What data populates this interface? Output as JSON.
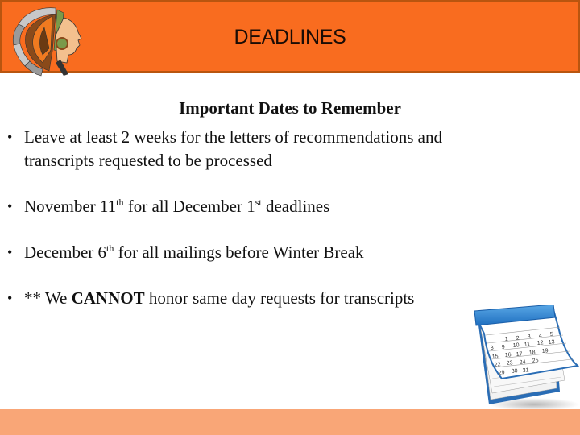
{
  "header": {
    "title": "DEADLINES",
    "logo_icon": "chief-headdress-logo",
    "background_color": "#F96C1F",
    "border_color": "#B9550F"
  },
  "main": {
    "subtitle": "Important Dates to Remember",
    "bullets": [
      {
        "text": "Leave at least 2 weeks for the letters of recommendations and transcripts requested to be processed"
      },
      {
        "part1": "November 11",
        "sup1": "th",
        "part2": " for all December 1",
        "sup2": "st",
        "part3": " deadlines"
      },
      {
        "part1": "December 6",
        "sup1": "th",
        "part2": " for all mailings before Winter Break"
      },
      {
        "prefix": "** We ",
        "bold": "CANNOT",
        "suffix": " honor same day requests for transcripts"
      }
    ],
    "bullet_glyph": "•",
    "image_icon": "calendar-icon"
  },
  "footer": {
    "background_color": "#F9A677"
  }
}
